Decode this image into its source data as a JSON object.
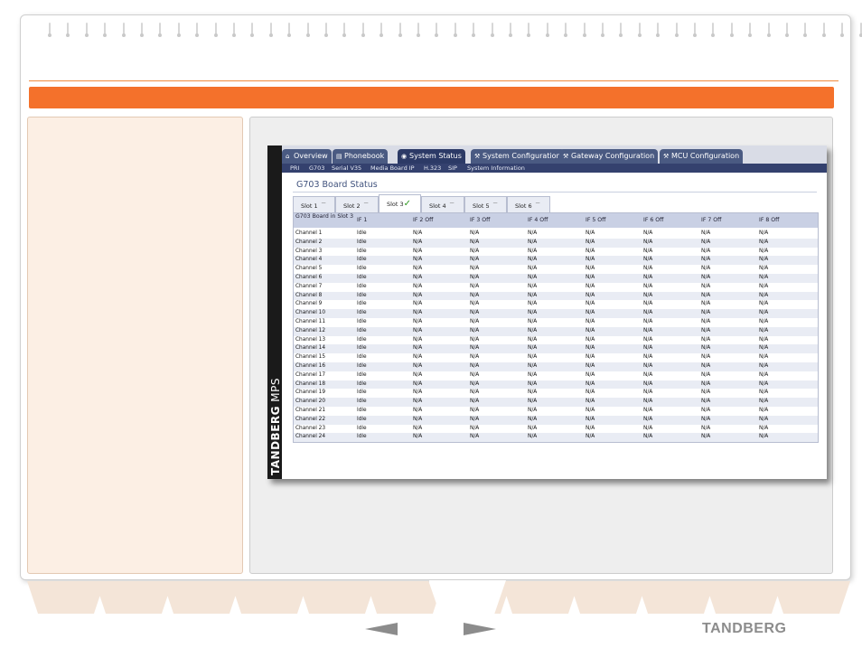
{
  "colors": {
    "accent": "#f4712b",
    "panel": "#fcefe4",
    "nav": "#4a5a82",
    "nav_active": "#2c3a66"
  },
  "app": {
    "brand": "TANDBERG",
    "product": "MPS",
    "tabs": [
      {
        "label": "Overview",
        "icon": "home-icon"
      },
      {
        "label": "Phonebook",
        "icon": "book-icon"
      },
      {
        "label": "System Status",
        "icon": "eye-icon"
      },
      {
        "label": "System Configuration",
        "icon": "wrench-icon"
      },
      {
        "label": "Gateway Configuration",
        "icon": "wrench-icon"
      },
      {
        "label": "MCU Configuration",
        "icon": "wrench-icon"
      }
    ],
    "subnav": [
      "PRI",
      "G703",
      "Serial V35",
      "Media Board IP",
      "H.323",
      "SIP",
      "System Information"
    ],
    "page_title": "G703 Board Status",
    "slots": [
      {
        "label": "Slot 1",
        "mark": "—"
      },
      {
        "label": "Slot 2",
        "mark": "—"
      },
      {
        "label": "Slot 3",
        "mark": "✓"
      },
      {
        "label": "Slot 4",
        "mark": "—"
      },
      {
        "label": "Slot 5",
        "mark": "—"
      },
      {
        "label": "Slot 6",
        "mark": "—"
      }
    ],
    "table": {
      "headers": [
        "G703 Board in Slot 3",
        "IF 1",
        "IF 2 Off",
        "IF 3 Off",
        "IF 4 Off",
        "IF 5 Off",
        "IF 6 Off",
        "IF 7 Off",
        "IF 8 Off"
      ],
      "rows": [
        [
          "Channel 1",
          "Idle",
          "N/A",
          "N/A",
          "N/A",
          "N/A",
          "N/A",
          "N/A",
          "N/A"
        ],
        [
          "Channel 2",
          "Idle",
          "N/A",
          "N/A",
          "N/A",
          "N/A",
          "N/A",
          "N/A",
          "N/A"
        ],
        [
          "Channel 3",
          "Idle",
          "N/A",
          "N/A",
          "N/A",
          "N/A",
          "N/A",
          "N/A",
          "N/A"
        ],
        [
          "Channel 4",
          "Idle",
          "N/A",
          "N/A",
          "N/A",
          "N/A",
          "N/A",
          "N/A",
          "N/A"
        ],
        [
          "Channel 5",
          "Idle",
          "N/A",
          "N/A",
          "N/A",
          "N/A",
          "N/A",
          "N/A",
          "N/A"
        ],
        [
          "Channel 6",
          "Idle",
          "N/A",
          "N/A",
          "N/A",
          "N/A",
          "N/A",
          "N/A",
          "N/A"
        ],
        [
          "Channel 7",
          "Idle",
          "N/A",
          "N/A",
          "N/A",
          "N/A",
          "N/A",
          "N/A",
          "N/A"
        ],
        [
          "Channel 8",
          "Idle",
          "N/A",
          "N/A",
          "N/A",
          "N/A",
          "N/A",
          "N/A",
          "N/A"
        ],
        [
          "Channel 9",
          "Idle",
          "N/A",
          "N/A",
          "N/A",
          "N/A",
          "N/A",
          "N/A",
          "N/A"
        ],
        [
          "Channel 10",
          "Idle",
          "N/A",
          "N/A",
          "N/A",
          "N/A",
          "N/A",
          "N/A",
          "N/A"
        ],
        [
          "Channel 11",
          "Idle",
          "N/A",
          "N/A",
          "N/A",
          "N/A",
          "N/A",
          "N/A",
          "N/A"
        ],
        [
          "Channel 12",
          "Idle",
          "N/A",
          "N/A",
          "N/A",
          "N/A",
          "N/A",
          "N/A",
          "N/A"
        ],
        [
          "Channel 13",
          "Idle",
          "N/A",
          "N/A",
          "N/A",
          "N/A",
          "N/A",
          "N/A",
          "N/A"
        ],
        [
          "Channel 14",
          "Idle",
          "N/A",
          "N/A",
          "N/A",
          "N/A",
          "N/A",
          "N/A",
          "N/A"
        ],
        [
          "Channel 15",
          "Idle",
          "N/A",
          "N/A",
          "N/A",
          "N/A",
          "N/A",
          "N/A",
          "N/A"
        ],
        [
          "Channel 16",
          "Idle",
          "N/A",
          "N/A",
          "N/A",
          "N/A",
          "N/A",
          "N/A",
          "N/A"
        ],
        [
          "Channel 17",
          "Idle",
          "N/A",
          "N/A",
          "N/A",
          "N/A",
          "N/A",
          "N/A",
          "N/A"
        ],
        [
          "Channel 18",
          "Idle",
          "N/A",
          "N/A",
          "N/A",
          "N/A",
          "N/A",
          "N/A",
          "N/A"
        ],
        [
          "Channel 19",
          "Idle",
          "N/A",
          "N/A",
          "N/A",
          "N/A",
          "N/A",
          "N/A",
          "N/A"
        ],
        [
          "Channel 20",
          "Idle",
          "N/A",
          "N/A",
          "N/A",
          "N/A",
          "N/A",
          "N/A",
          "N/A"
        ],
        [
          "Channel 21",
          "Idle",
          "N/A",
          "N/A",
          "N/A",
          "N/A",
          "N/A",
          "N/A",
          "N/A"
        ],
        [
          "Channel 22",
          "Idle",
          "N/A",
          "N/A",
          "N/A",
          "N/A",
          "N/A",
          "N/A",
          "N/A"
        ],
        [
          "Channel 23",
          "Idle",
          "N/A",
          "N/A",
          "N/A",
          "N/A",
          "N/A",
          "N/A",
          "N/A"
        ],
        [
          "Channel 24",
          "Idle",
          "N/A",
          "N/A",
          "N/A",
          "N/A",
          "N/A",
          "N/A",
          "N/A"
        ]
      ]
    }
  },
  "footer": {
    "logo": "TANDBERG",
    "prev_icon": "arrow-left-icon",
    "next_icon": "arrow-right-icon"
  }
}
